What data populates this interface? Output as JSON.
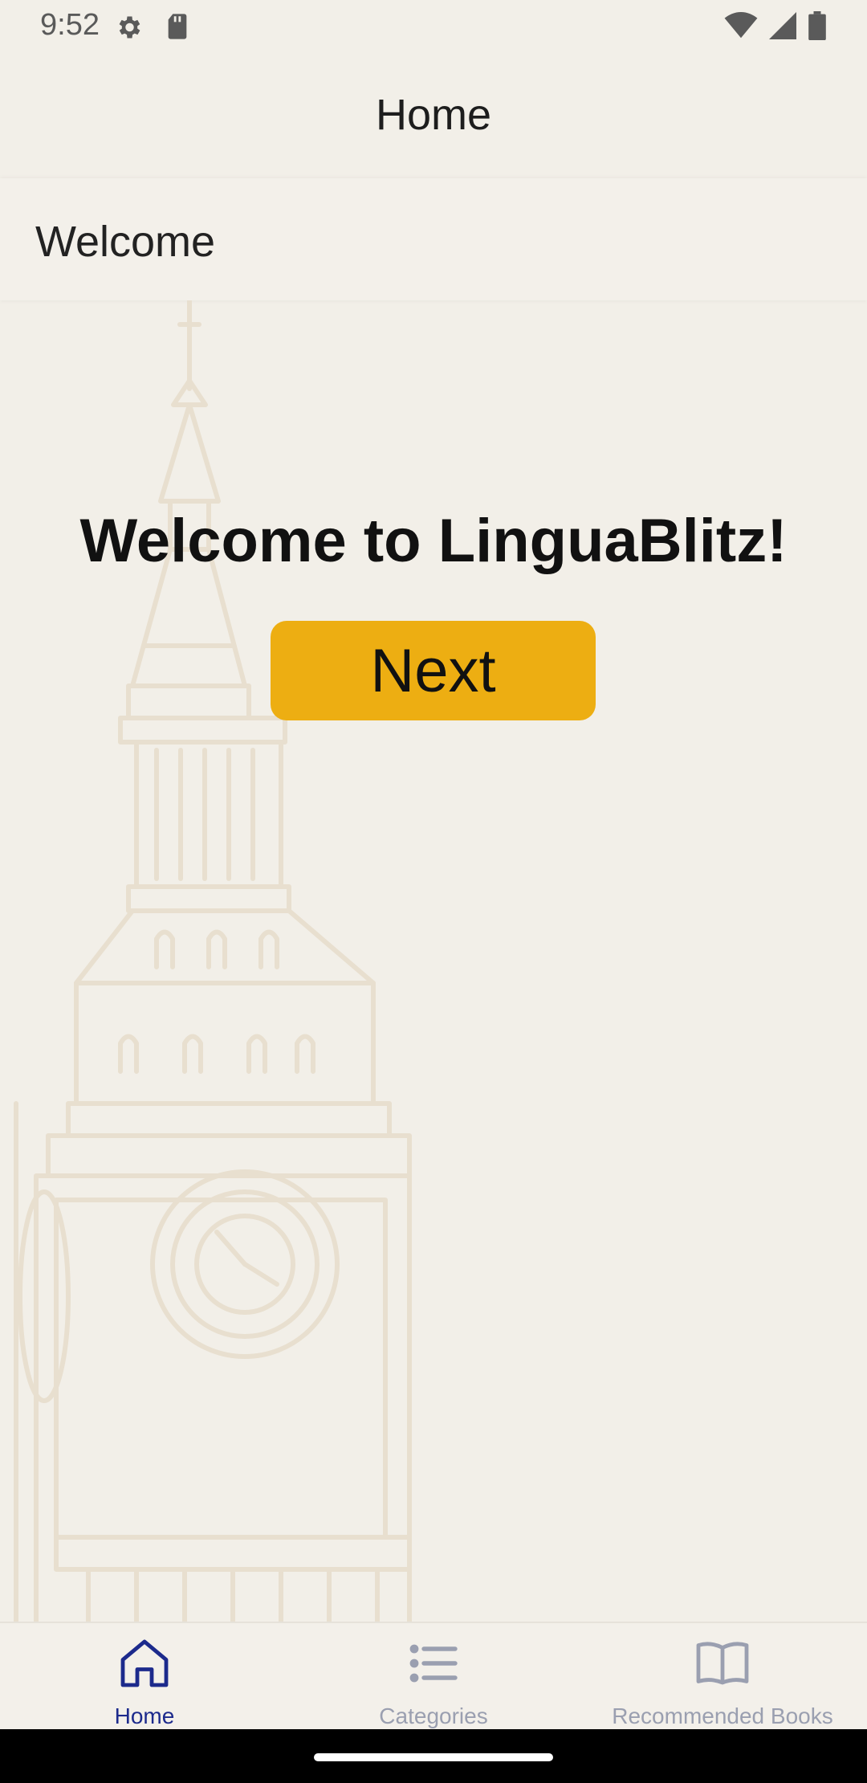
{
  "status_bar": {
    "time": "9:52",
    "icons": [
      "gear-icon",
      "sd-card-icon",
      "wifi-icon",
      "signal-icon",
      "battery-icon"
    ]
  },
  "app_bar": {
    "title": "Home"
  },
  "section": {
    "title": "Welcome"
  },
  "main": {
    "heading": "Welcome to LinguaBlitz!",
    "next_label": "Next"
  },
  "bottom_nav": {
    "items": [
      {
        "label": "Home",
        "icon": "home-icon",
        "active": true
      },
      {
        "label": "Categories",
        "icon": "list-icon",
        "active": false
      },
      {
        "label": "Recommended Books",
        "icon": "book-icon",
        "active": false
      }
    ]
  },
  "colors": {
    "background": "#f2efe8",
    "button": "#edae12",
    "nav_active": "#1c2a8c",
    "nav_inactive": "#9a9fb0",
    "illustration": "#e8dfcf"
  }
}
